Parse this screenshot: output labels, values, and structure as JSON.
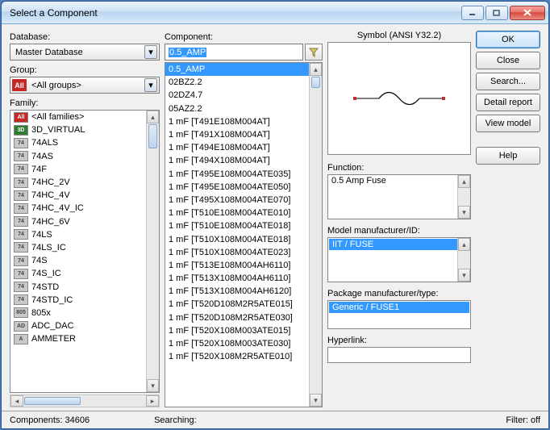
{
  "window": {
    "title": "Select a Component"
  },
  "left": {
    "database_label": "Database:",
    "database_value": "Master Database",
    "group_label": "Group:",
    "group_value": "<All groups>",
    "family_label": "Family:",
    "families": [
      {
        "icon": "All",
        "bg": "#c62828",
        "fg": "#fff",
        "label": "<All families>"
      },
      {
        "icon": "3D",
        "bg": "#2e7d32",
        "fg": "#fff",
        "label": "3D_VIRTUAL"
      },
      {
        "icon": "74",
        "bg": "#c8c8c8",
        "fg": "#444",
        "label": "74ALS"
      },
      {
        "icon": "74",
        "bg": "#c8c8c8",
        "fg": "#444",
        "label": "74AS"
      },
      {
        "icon": "74",
        "bg": "#c8c8c8",
        "fg": "#444",
        "label": "74F"
      },
      {
        "icon": "74",
        "bg": "#c8c8c8",
        "fg": "#444",
        "label": "74HC_2V"
      },
      {
        "icon": "74",
        "bg": "#c8c8c8",
        "fg": "#444",
        "label": "74HC_4V"
      },
      {
        "icon": "74",
        "bg": "#c8c8c8",
        "fg": "#444",
        "label": "74HC_4V_IC"
      },
      {
        "icon": "74",
        "bg": "#c8c8c8",
        "fg": "#444",
        "label": "74HC_6V"
      },
      {
        "icon": "74",
        "bg": "#c8c8c8",
        "fg": "#444",
        "label": "74LS"
      },
      {
        "icon": "74",
        "bg": "#c8c8c8",
        "fg": "#444",
        "label": "74LS_IC"
      },
      {
        "icon": "74",
        "bg": "#c8c8c8",
        "fg": "#444",
        "label": "74S"
      },
      {
        "icon": "74",
        "bg": "#c8c8c8",
        "fg": "#444",
        "label": "74S_IC"
      },
      {
        "icon": "74",
        "bg": "#c8c8c8",
        "fg": "#444",
        "label": "74STD"
      },
      {
        "icon": "74",
        "bg": "#c8c8c8",
        "fg": "#444",
        "label": "74STD_IC"
      },
      {
        "icon": "805",
        "bg": "#c8c8c8",
        "fg": "#444",
        "label": "805x"
      },
      {
        "icon": "AD",
        "bg": "#c8c8c8",
        "fg": "#444",
        "label": "ADC_DAC"
      },
      {
        "icon": "A",
        "bg": "#c8c8c8",
        "fg": "#444",
        "label": "AMMETER"
      }
    ]
  },
  "mid": {
    "component_label": "Component:",
    "search_value": "0.5_AMP",
    "items": [
      "0.5_AMP",
      "02BZ2.2",
      "02DZ4.7",
      "05AZ2.2",
      "1 mF [T491E108M004AT]",
      "1 mF [T491X108M004AT]",
      "1 mF [T494E108M004AT]",
      "1 mF [T494X108M004AT]",
      "1 mF [T495E108M004ATE035]",
      "1 mF [T495E108M004ATE050]",
      "1 mF [T495X108M004ATE070]",
      "1 mF [T510E108M004ATE010]",
      "1 mF [T510E108M004ATE018]",
      "1 mF [T510X108M004ATE018]",
      "1 mF [T510X108M004ATE023]",
      "1 mF [T513E108M004AH6110]",
      "1 mF [T513X108M004AH6110]",
      "1 mF [T513X108M004AH6120]",
      "1 mF [T520D108M2R5ATE015]",
      "1 mF [T520D108M2R5ATE030]",
      "1 mF [T520X108M003ATE015]",
      "1 mF [T520X108M003ATE030]",
      "1 mF [T520X108M2R5ATE010]"
    ],
    "selected_index": 0
  },
  "right": {
    "symbol_label": "Symbol (ANSI Y32.2)",
    "function_label": "Function:",
    "function_value": "0.5 Amp Fuse",
    "model_label": "Model manufacturer/ID:",
    "model_value": "IIT / FUSE",
    "package_label": "Package manufacturer/type:",
    "package_value": "Generic / FUSE1",
    "hyperlink_label": "Hyperlink:",
    "hyperlink_value": ""
  },
  "buttons": {
    "ok": "OK",
    "close": "Close",
    "search": "Search...",
    "detail": "Detail report",
    "view": "View model",
    "help": "Help"
  },
  "status": {
    "components": "Components: 34606",
    "searching": "Searching:",
    "filter": "Filter: off"
  }
}
